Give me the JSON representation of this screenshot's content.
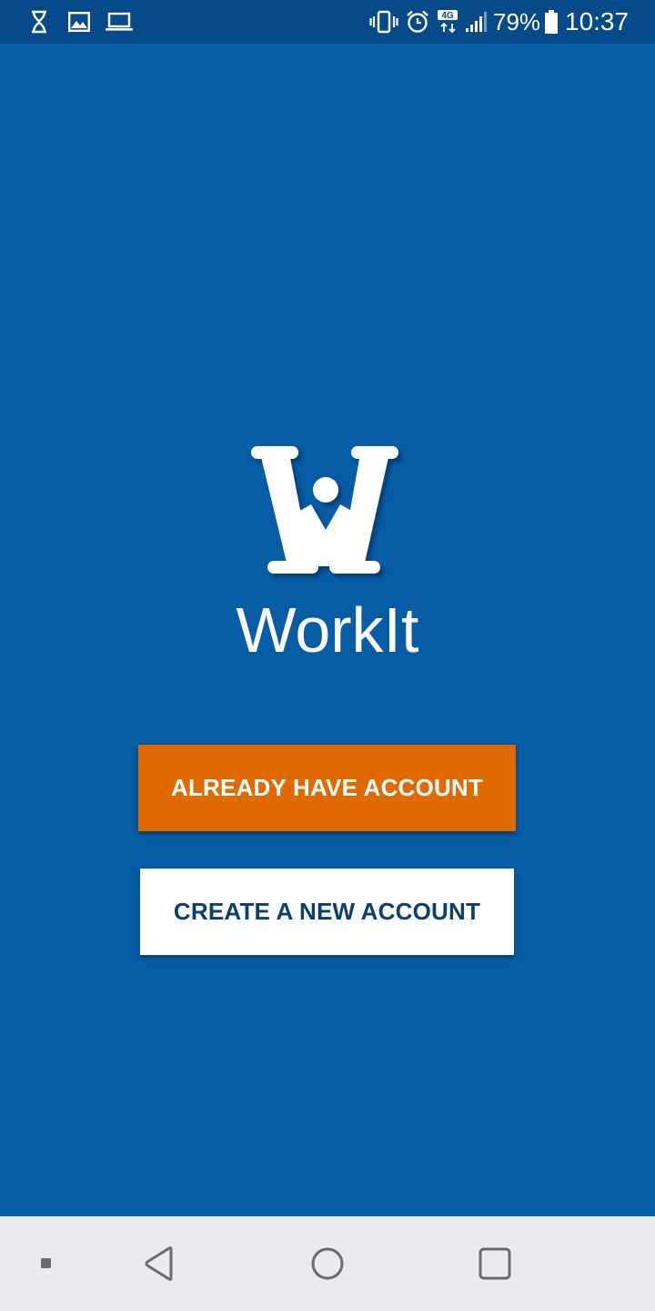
{
  "status_bar": {
    "battery_percent": "79%",
    "time": "10:37",
    "network_badge": "4G",
    "icons": [
      "hourglass-icon",
      "image-icon",
      "laptop-icon",
      "vibrate-icon",
      "alarm-icon",
      "network-4g-icon",
      "signal-icon",
      "battery-icon"
    ]
  },
  "app": {
    "name": "WorkIt",
    "logo_icon": "workit-logo-icon"
  },
  "actions": {
    "login_label": "ALREADY HAVE ACCOUNT",
    "create_label": "CREATE A NEW ACCOUNT"
  },
  "nav_bar": {
    "icons": [
      "dot-icon",
      "back-icon",
      "home-icon",
      "recents-icon"
    ]
  },
  "colors": {
    "background": "#075ca6",
    "status_bar": "#064a8a",
    "primary_button": "#e06a00",
    "secondary_button": "#ffffff",
    "secondary_button_text": "#0b3f6e",
    "nav_bar": "#eaebee"
  }
}
